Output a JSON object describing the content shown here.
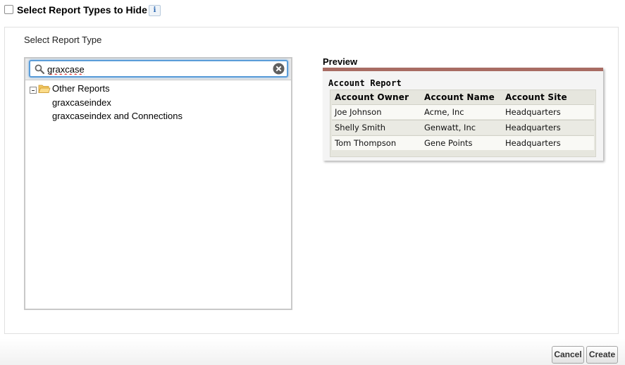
{
  "header": {
    "checkbox_checked": false,
    "title": "Select Report Types to Hide",
    "info_icon": "info-icon",
    "info_glyph": "i"
  },
  "selector": {
    "label": "Select Report Type",
    "search": {
      "value": "graxcase",
      "placeholder": ""
    },
    "tree": {
      "folder": {
        "label": "Other Reports",
        "expanded": true,
        "icon": "folder-open-icon"
      },
      "items": [
        {
          "label": "graxcaseindex"
        },
        {
          "label": "graxcaseindex and Connections"
        }
      ]
    }
  },
  "preview": {
    "heading": "Preview",
    "report_title": "Account Report",
    "columns": [
      "Account  Owner",
      "Account Name",
      "Account Site"
    ],
    "rows": [
      [
        "Joe Johnson",
        "Acme, Inc",
        "Headquarters"
      ],
      [
        "Shelly Smith",
        "Genwatt, Inc",
        "Headquarters"
      ],
      [
        "Tom Thompson",
        "Gene Points",
        "Headquarters"
      ]
    ],
    "accent_color": "#a86c63"
  },
  "footer": {
    "cancel_label": "Cancel",
    "create_label": "Create"
  },
  "colors": {
    "focus_border": "#5b9dd9",
    "info_blue": "#2a67b1"
  }
}
